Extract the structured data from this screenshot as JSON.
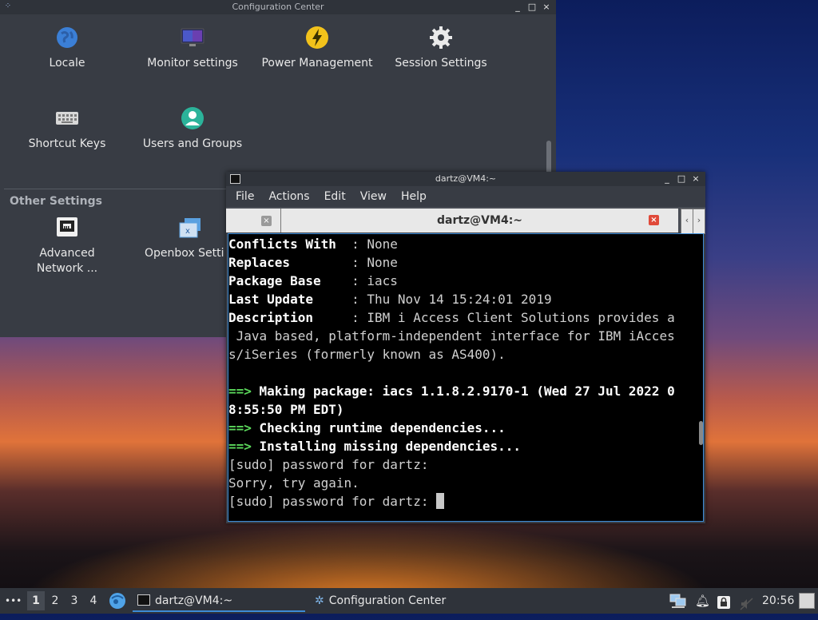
{
  "config_window": {
    "title": "Configuration Center",
    "controls": [
      "_",
      "□",
      "×"
    ],
    "items": [
      {
        "label": "Locale",
        "icon": "globe-icon"
      },
      {
        "label": "Monitor settings",
        "icon": "monitor-icon"
      },
      {
        "label": "Power Management",
        "icon": "power-icon"
      },
      {
        "label": "Session Settings",
        "icon": "gear-icon"
      },
      {
        "label": "Shortcut Keys",
        "icon": "keyboard-icon"
      },
      {
        "label": "Users and Groups",
        "icon": "user-icon"
      }
    ],
    "section_title": "Other Settings",
    "other_items": [
      {
        "label": "Advanced Network ...",
        "icon": "network-icon"
      },
      {
        "label": "Openbox Settin",
        "icon": "openbox-icon"
      }
    ]
  },
  "terminal_window": {
    "title": "dartz@VM4:~",
    "menu": [
      "File",
      "Actions",
      "Edit",
      "View",
      "Help"
    ],
    "tab_title": "dartz@VM4:~",
    "lines": [
      {
        "prefix": "",
        "key": "Conflicts With  ",
        "text": ": None"
      },
      {
        "prefix": "",
        "key": "Replaces        ",
        "text": ": None"
      },
      {
        "prefix": "",
        "key": "Package Base    ",
        "text": ": iacs"
      },
      {
        "prefix": "",
        "key": "Last Update     ",
        "text": ": Thu Nov 14 15:24:01 2019"
      },
      {
        "prefix": "",
        "key": "Description     ",
        "text": ": IBM i Access Client Solutions provides a"
      },
      {
        "prefix": "",
        "key": "",
        "text": " Java based, platform-independent interface for IBM iAcces"
      },
      {
        "prefix": "",
        "key": "",
        "text": "s/iSeries (formerly known as AS400)."
      },
      {
        "prefix": "",
        "key": "",
        "text": ""
      },
      {
        "prefix": "==>",
        "key": " Making package: iacs 1.1.8.2.9170-1 (Wed 27 Jul 2022 0",
        "text": ""
      },
      {
        "prefix": "",
        "key": "8:55:50 PM EDT)",
        "text": ""
      },
      {
        "prefix": "==>",
        "key": " Checking runtime dependencies...",
        "text": ""
      },
      {
        "prefix": "==>",
        "key": " Installing missing dependencies...",
        "text": ""
      },
      {
        "prefix": "",
        "key": "",
        "text": "[sudo] password for dartz:"
      },
      {
        "prefix": "",
        "key": "",
        "text": "Sorry, try again."
      },
      {
        "prefix": "",
        "key": "",
        "text": "[sudo] password for dartz: "
      }
    ]
  },
  "taskbar": {
    "menu_dots": "•••",
    "workspaces": [
      "1",
      "2",
      "3",
      "4"
    ],
    "active_workspace": "1",
    "tasks": [
      {
        "label": "dartz@VM4:~",
        "icon": "terminal-icon"
      },
      {
        "label": "Configuration Center",
        "icon": "config-icon"
      }
    ],
    "clock": "20:56"
  }
}
